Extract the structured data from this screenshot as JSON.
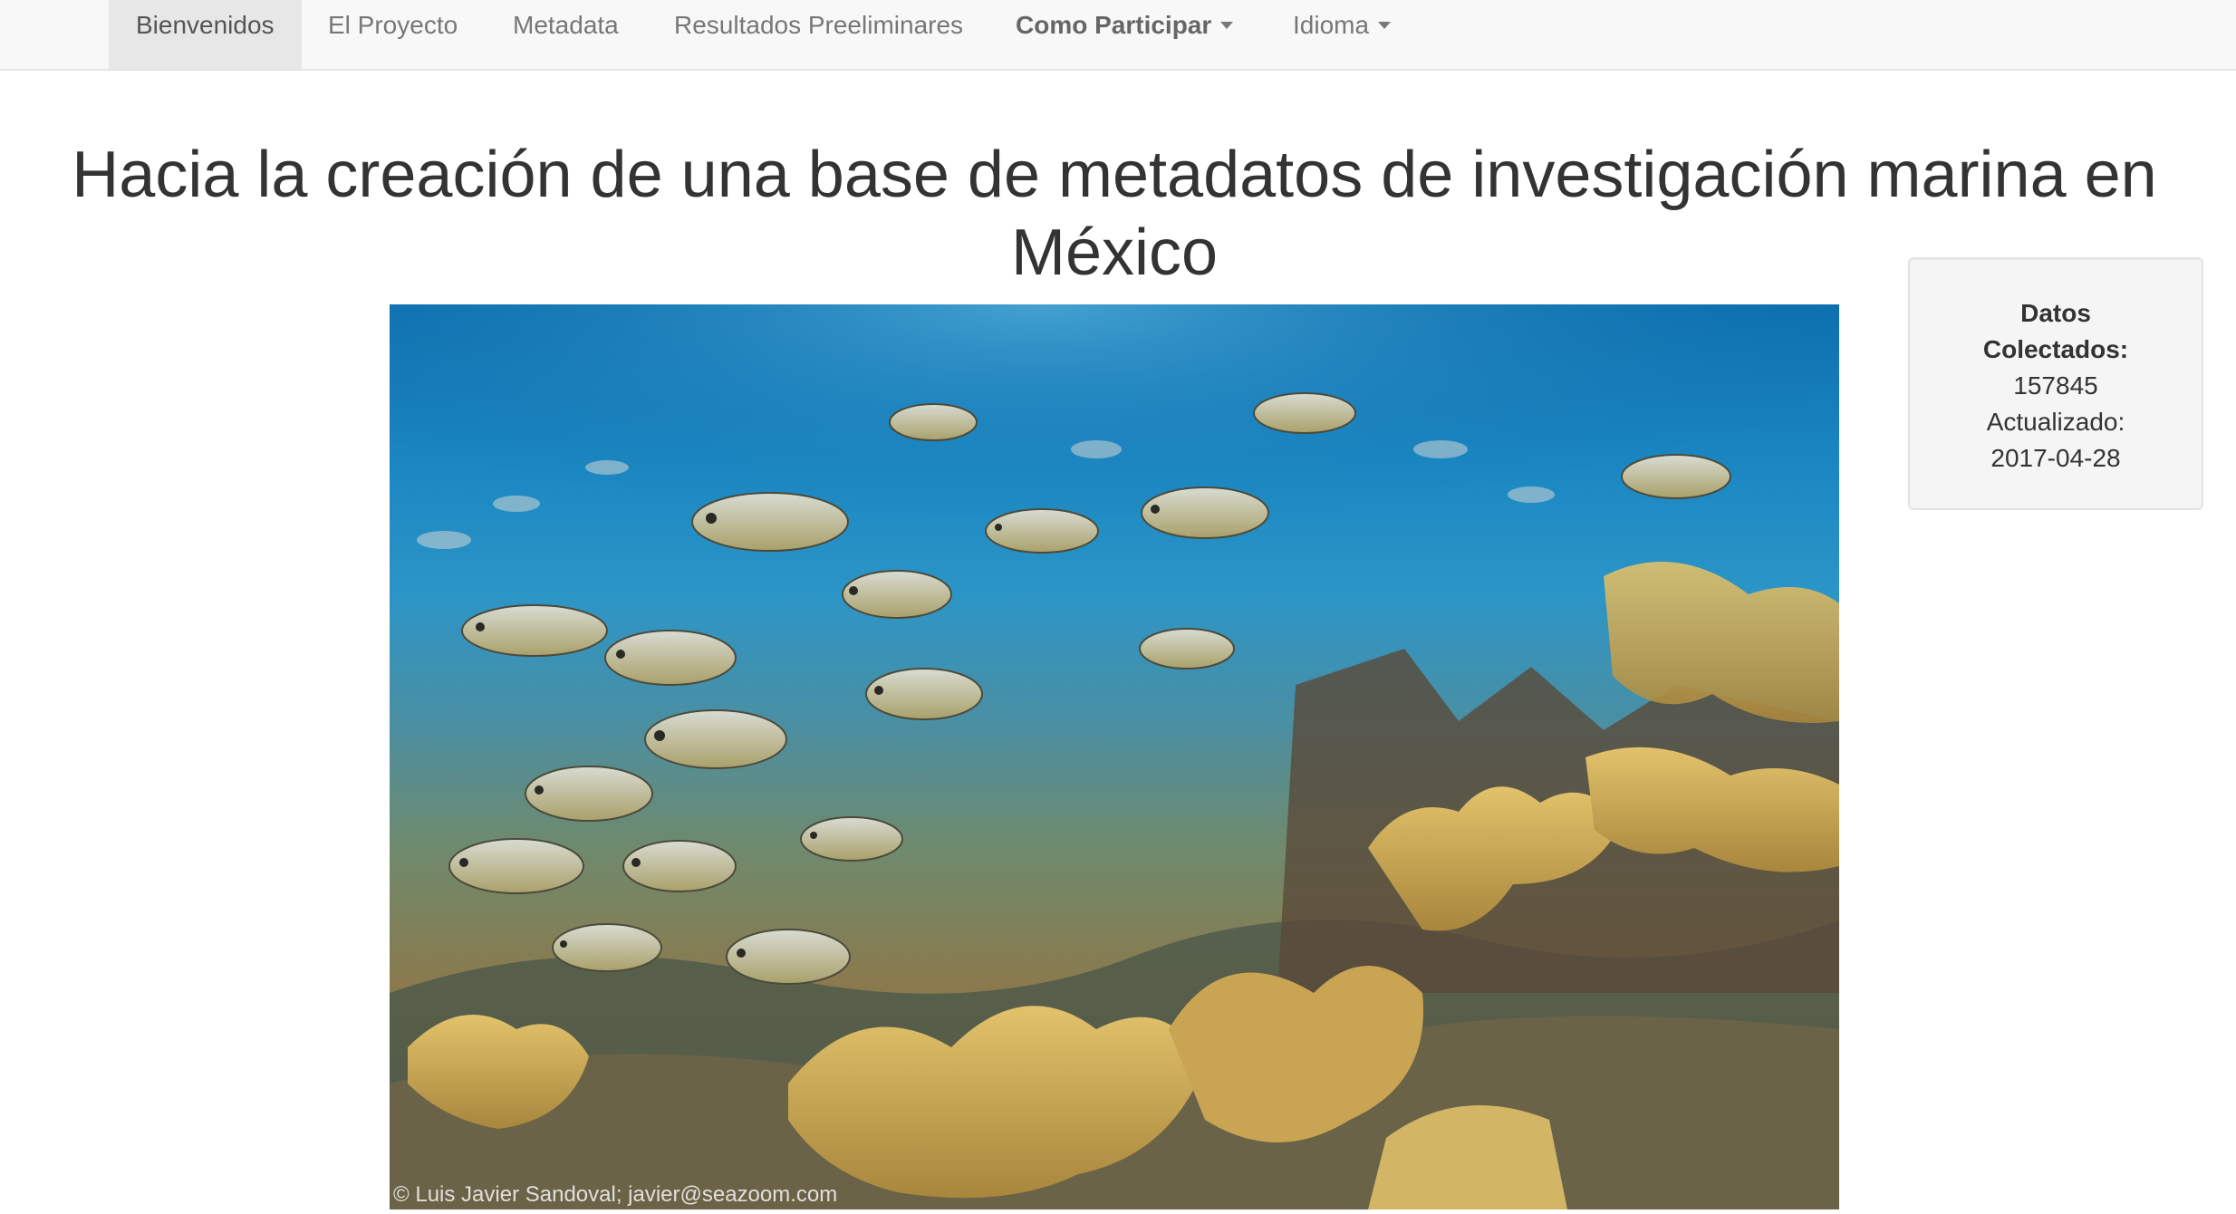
{
  "nav": {
    "items": [
      {
        "label": "Bienvenidos"
      },
      {
        "label": "El Proyecto"
      },
      {
        "label": "Metadata"
      },
      {
        "label": "Resultados Preeliminares"
      },
      {
        "label": "Como Participar"
      },
      {
        "label": "Idioma"
      }
    ]
  },
  "page": {
    "title_line1": "Hacia la creación de una base de metadatos de investigación marina en",
    "title_line2": "México"
  },
  "hero": {
    "credit": "© Luis Javier Sandoval; javier@seazoom.com"
  },
  "stats": {
    "collected_label_1": "Datos",
    "collected_label_2": "Colectados:",
    "collected_value": "157845",
    "updated_label": "Actualizado:",
    "updated_value": "2017-04-28"
  },
  "colors": {
    "navbar_bg": "#f8f8f8",
    "active_tab_bg": "#e7e7e7",
    "text": "#333333",
    "well_bg": "#f5f5f5"
  }
}
